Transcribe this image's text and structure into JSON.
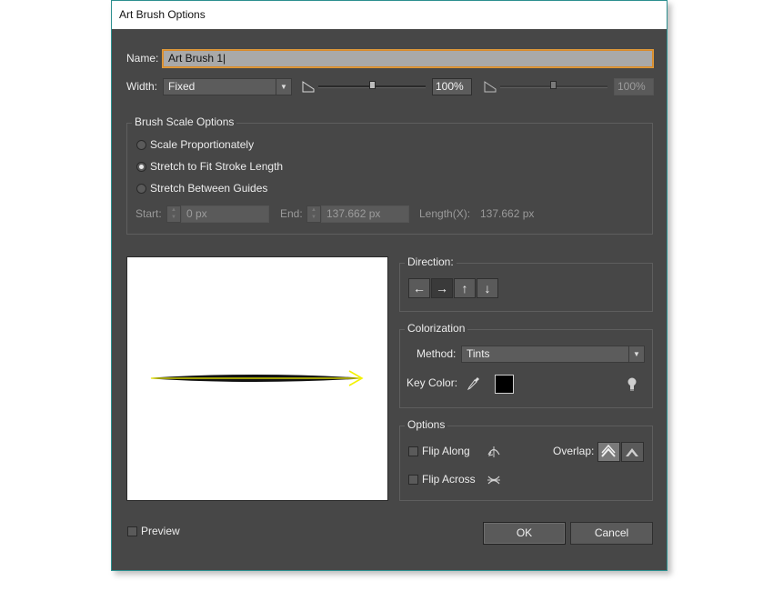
{
  "window": {
    "title": "Art Brush Options"
  },
  "name_row": {
    "label": "Name:",
    "value": "Art Brush 1"
  },
  "width_row": {
    "label": "Width:",
    "select_value": "Fixed",
    "slider1_value": "100%",
    "slider2_value": "100%"
  },
  "scale_options": {
    "title": "Brush Scale Options",
    "radios": [
      {
        "label": "Scale Proportionately",
        "selected": false
      },
      {
        "label": "Stretch to Fit Stroke Length",
        "selected": true
      },
      {
        "label": "Stretch Between Guides",
        "selected": false
      }
    ],
    "start_label": "Start:",
    "start_value": "0 px",
    "end_label": "End:",
    "end_value": "137.662 px",
    "length_label": "Length(X):",
    "length_value": "137.662 px"
  },
  "direction": {
    "title": "Direction:",
    "buttons": [
      {
        "icon": "arrow-left-icon",
        "glyph": "←"
      },
      {
        "icon": "arrow-right-icon",
        "glyph": "→",
        "selected": true
      },
      {
        "icon": "arrow-up-icon",
        "glyph": "↑"
      },
      {
        "icon": "arrow-down-icon",
        "glyph": "↓"
      }
    ]
  },
  "colorization": {
    "title": "Colorization",
    "method_label": "Method:",
    "method_value": "Tints",
    "key_color_label": "Key Color:",
    "key_color": "#000000"
  },
  "options": {
    "title": "Options",
    "flip_along_label": "Flip Along",
    "flip_across_label": "Flip Across",
    "overlap_label": "Overlap:"
  },
  "footer": {
    "preview_label": "Preview",
    "ok_label": "OK",
    "cancel_label": "Cancel"
  },
  "colors": {
    "dialog_bg": "#474747",
    "accent_border": "#2c8f8f",
    "focus_ring": "#d88a2a"
  }
}
